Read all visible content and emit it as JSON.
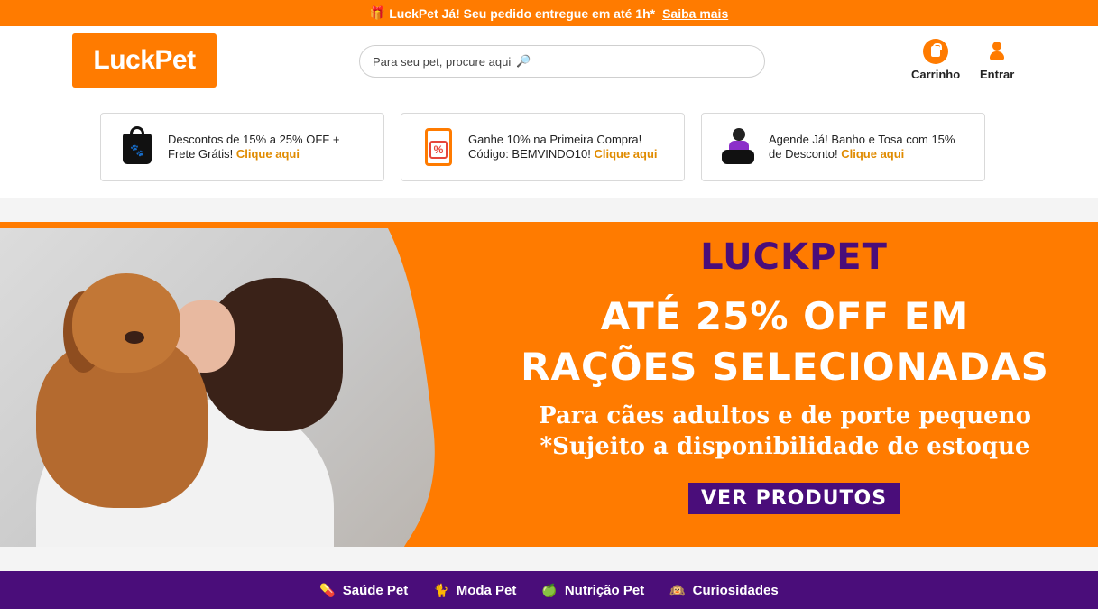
{
  "topbar": {
    "gift_icon": "gift-icon",
    "message": "LuckPet Já! Seu pedido entregue em até 1h*",
    "link": "Saiba mais"
  },
  "header": {
    "logo": "LuckPet",
    "search_placeholder": "Para seu pet, procure aqui",
    "search_icon": "search-icon",
    "cart_label": "Carrinho",
    "login_label": "Entrar"
  },
  "promos": [
    {
      "icon": "shopping-bag-paw-icon",
      "line1": "Descontos de 15% a 25% OFF +",
      "line2": "Frete Grátis!",
      "link": "Clique aqui"
    },
    {
      "icon": "coupon-percent-icon",
      "line1": "Ganhe 10% na Primeira Compra!",
      "line2": "Código: BEMVINDO10!",
      "link": "Clique aqui"
    },
    {
      "icon": "pet-grooming-icon",
      "line1": "Agende Já! Banho e Tosa com 15%",
      "line2": "de Desconto!",
      "link": "Clique aqui"
    }
  ],
  "hero": {
    "brand": "LUCKPET",
    "headline1": "ATÉ 25% OFF EM",
    "headline2": "RAÇÕES SELECIONADAS",
    "sub1": "Para cães adultos e de porte pequeno",
    "sub2": "*Sujeito a disponibilidade de estoque",
    "cta": "VER PRODUTOS"
  },
  "categories": [
    {
      "emoji": "💊",
      "label": "Saúde Pet"
    },
    {
      "emoji": "🐈",
      "label": "Moda Pet"
    },
    {
      "emoji": "🍏",
      "label": "Nutrição Pet"
    },
    {
      "emoji": "🙉",
      "label": "Curiosidades"
    }
  ],
  "colors": {
    "brand_orange": "#ff7b00",
    "brand_purple": "#4a0d7a",
    "link_gold": "#e08b00"
  }
}
